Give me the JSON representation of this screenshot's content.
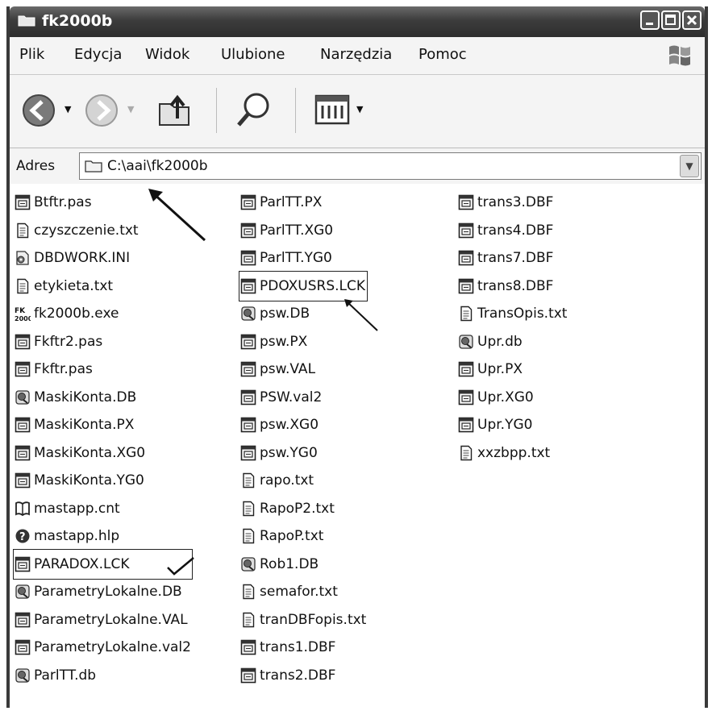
{
  "window": {
    "title": "fk2000b"
  },
  "menu": [
    "Plik",
    "Edycja",
    "Widok",
    "Ulubione",
    "Narzędzia",
    "Pomoc"
  ],
  "toolbar": {
    "back": "back-icon",
    "forward": "forward-icon",
    "up": "folder-up-icon",
    "search": "search-icon",
    "views": "views-icon"
  },
  "address": {
    "label": "Adres",
    "value": "C:\\aai\\fk2000b"
  },
  "files": [
    [
      {
        "name": "Btftr.pas",
        "icon": "app-file-icon"
      },
      {
        "name": "czyszczenie.txt",
        "icon": "text-file-icon"
      },
      {
        "name": "DBDWORK.INI",
        "icon": "config-file-icon"
      },
      {
        "name": "etykieta.txt",
        "icon": "text-file-icon"
      },
      {
        "name": "fk2000b.exe",
        "icon": "fk-exe-icon"
      },
      {
        "name": "Fkftr2.pas",
        "icon": "app-file-icon"
      },
      {
        "name": "Fkftr.pas",
        "icon": "app-file-icon"
      },
      {
        "name": "MaskiKonta.DB",
        "icon": "db-file-icon"
      },
      {
        "name": "MaskiKonta.PX",
        "icon": "app-file-icon"
      },
      {
        "name": "MaskiKonta.XG0",
        "icon": "app-file-icon"
      },
      {
        "name": "MaskiKonta.YG0",
        "icon": "app-file-icon"
      },
      {
        "name": "mastapp.cnt",
        "icon": "help-contents-icon"
      },
      {
        "name": "mastapp.hlp",
        "icon": "help-file-icon"
      },
      {
        "name": "PARADOX.LCK",
        "icon": "app-file-icon",
        "boxed": true
      },
      {
        "name": "ParametryLokalne.DB",
        "icon": "db-file-icon"
      },
      {
        "name": "ParametryLokalne.VAL",
        "icon": "app-file-icon"
      },
      {
        "name": "ParametryLokalne.val2",
        "icon": "app-file-icon"
      },
      {
        "name": "ParlTT.db",
        "icon": "db-file-icon"
      }
    ],
    [
      {
        "name": "ParlTT.PX",
        "icon": "app-file-icon"
      },
      {
        "name": "ParlTT.XG0",
        "icon": "app-file-icon"
      },
      {
        "name": "ParlTT.YG0",
        "icon": "app-file-icon"
      },
      {
        "name": "PDOXUSRS.LCK",
        "icon": "app-file-icon",
        "boxed": true
      },
      {
        "name": "psw.DB",
        "icon": "db-file-icon"
      },
      {
        "name": "psw.PX",
        "icon": "app-file-icon"
      },
      {
        "name": "psw.VAL",
        "icon": "app-file-icon"
      },
      {
        "name": "PSW.val2",
        "icon": "app-file-icon"
      },
      {
        "name": "psw.XG0",
        "icon": "app-file-icon"
      },
      {
        "name": "psw.YG0",
        "icon": "app-file-icon"
      },
      {
        "name": "rapo.txt",
        "icon": "text-file-icon"
      },
      {
        "name": "RapoP2.txt",
        "icon": "text-file-icon"
      },
      {
        "name": "RapoP.txt",
        "icon": "text-file-icon"
      },
      {
        "name": "Rob1.DB",
        "icon": "db-file-icon"
      },
      {
        "name": "semafor.txt",
        "icon": "text-file-icon"
      },
      {
        "name": "tranDBFopis.txt",
        "icon": "text-file-icon"
      },
      {
        "name": "trans1.DBF",
        "icon": "app-file-icon"
      },
      {
        "name": "trans2.DBF",
        "icon": "app-file-icon"
      }
    ],
    [
      {
        "name": "trans3.DBF",
        "icon": "app-file-icon"
      },
      {
        "name": "trans4.DBF",
        "icon": "app-file-icon"
      },
      {
        "name": "trans7.DBF",
        "icon": "app-file-icon"
      },
      {
        "name": "trans8.DBF",
        "icon": "app-file-icon"
      },
      {
        "name": "TransOpis.txt",
        "icon": "text-file-icon"
      },
      {
        "name": "Upr.db",
        "icon": "db-file-icon"
      },
      {
        "name": "Upr.PX",
        "icon": "app-file-icon"
      },
      {
        "name": "Upr.XG0",
        "icon": "app-file-icon"
      },
      {
        "name": "Upr.YG0",
        "icon": "app-file-icon"
      },
      {
        "name": "xxzbpp.txt",
        "icon": "text-file-icon"
      }
    ]
  ]
}
